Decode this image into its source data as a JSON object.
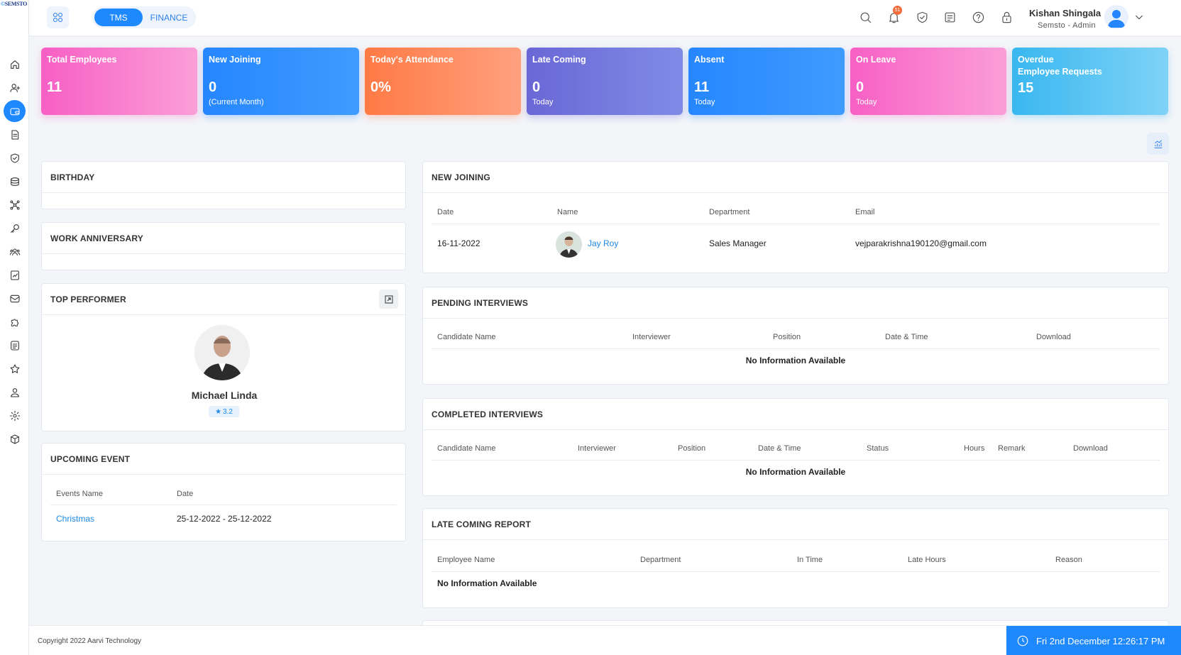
{
  "brand": {
    "logo_text": "SEMSTO"
  },
  "header": {
    "modules": [
      "TMS",
      "FINANCE"
    ],
    "notification_count": "51",
    "user_name": "Kishan Shingala",
    "user_role": "Semsto - Admin"
  },
  "sidebar": {
    "items": [
      "home-icon",
      "user-add-icon",
      "wallet-icon",
      "document-icon",
      "shield-check-icon",
      "briefcase-icon",
      "network-icon",
      "key-icon",
      "users-icon",
      "report-icon",
      "mail-icon",
      "puzzle-icon",
      "list-icon",
      "star-icon",
      "user-icon",
      "gear-icon",
      "box-icon"
    ],
    "active_index": 2
  },
  "stats": [
    {
      "title": "Total Employees",
      "value": "11",
      "sub": "",
      "color": "#f75fc4"
    },
    {
      "title": "New Joining",
      "value": "0",
      "sub": "(Current Month)",
      "color": "#2586ff"
    },
    {
      "title": "Today's Attendance",
      "value": "0%",
      "sub": "",
      "color": "#ff7a45"
    },
    {
      "title": "Late Coming",
      "value": "0",
      "sub": "Today",
      "color": "#6a67d6"
    },
    {
      "title": "Absent",
      "value": "11",
      "sub": "Today",
      "color": "#2586ff"
    },
    {
      "title": "On Leave",
      "value": "0",
      "sub": "Today",
      "color": "#f75fc4"
    },
    {
      "title": "Overdue",
      "title2": "Employee Requests",
      "value": "15",
      "sub": "",
      "color": "#39b7f0"
    }
  ],
  "birthday": {
    "title": "BIRTHDAY"
  },
  "anniversary": {
    "title": "WORK ANNIVERSARY"
  },
  "top_performer": {
    "title": "TOP PERFORMER",
    "name": "Michael Linda",
    "rating": "3.2"
  },
  "upcoming_event": {
    "title": "UPCOMING EVENT",
    "columns": [
      "Events Name",
      "Date"
    ],
    "rows": [
      {
        "name": "Christmas",
        "date": "25-12-2022 - 25-12-2022"
      }
    ]
  },
  "new_joining": {
    "title": "NEW JOINING",
    "columns": [
      "Date",
      "Name",
      "Department",
      "Email"
    ],
    "rows": [
      {
        "date": "16-11-2022",
        "name": "Jay Roy",
        "department": "Sales Manager",
        "email": "vejparakrishna190120@gmail.com"
      }
    ]
  },
  "pending_interviews": {
    "title": "PENDING INTERVIEWS",
    "columns": [
      "Candidate Name",
      "Interviewer",
      "Position",
      "Date & Time",
      "Download"
    ],
    "empty": "No Information Available"
  },
  "completed_interviews": {
    "title": "COMPLETED INTERVIEWS",
    "columns": [
      "Candidate Name",
      "Interviewer",
      "Position",
      "Date & Time",
      "Status",
      "Hours",
      "Remark",
      "Download"
    ],
    "empty": "No Information Available"
  },
  "late_coming": {
    "title": "LATE COMING REPORT",
    "columns": [
      "Employee Name",
      "Department",
      "In Time",
      "Late Hours",
      "Reason"
    ],
    "empty": "No Information Available"
  },
  "footer": {
    "copyright": "Copyright 2022 Aarvi Technology",
    "datetime": "Fri 2nd December 12:26:17 PM"
  }
}
